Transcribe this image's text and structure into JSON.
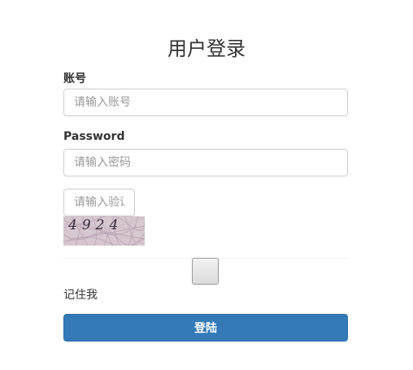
{
  "page": {
    "title": "用户登录"
  },
  "form": {
    "account_label": "账号",
    "account_placeholder": "请输入账号",
    "password_label": "Password",
    "password_placeholder": "请输入密码",
    "captcha_placeholder": "请输入验证码",
    "captcha_code": "4924",
    "remember_label": "记住我",
    "login_label": "登陆"
  },
  "colors": {
    "primary": "#337ab7",
    "captcha_bg": "#d6c7d0"
  }
}
